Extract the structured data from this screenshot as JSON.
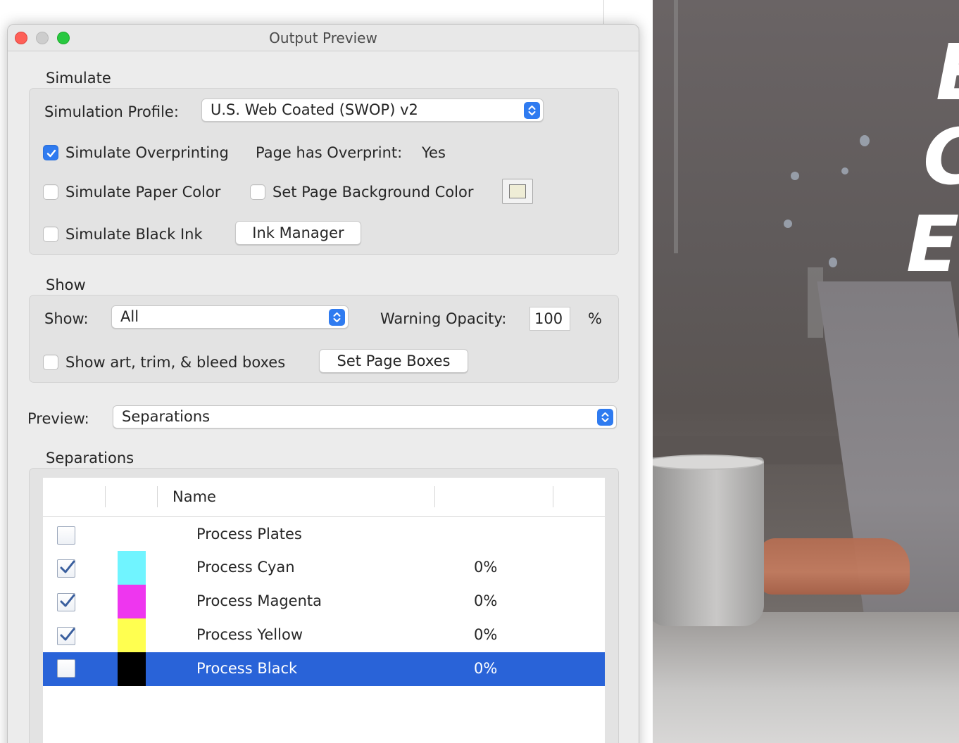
{
  "window": {
    "title": "Output Preview"
  },
  "simulate": {
    "section_title": "Simulate",
    "profile_label": "Simulation Profile:",
    "profile_value": "U.S. Web Coated (SWOP) v2",
    "overprinting_label": "Simulate Overprinting",
    "overprinting_checked": true,
    "page_has_overprint_label": "Page has Overprint:",
    "page_has_overprint_value": "Yes",
    "paper_color_label": "Simulate Paper Color",
    "paper_color_checked": false,
    "page_bg_label": "Set Page Background Color",
    "page_bg_checked": false,
    "page_bg_swatch_color": "#efedd6",
    "black_ink_label": "Simulate Black Ink",
    "black_ink_checked": false,
    "ink_manager_label": "Ink Manager"
  },
  "show": {
    "section_title": "Show",
    "show_label": "Show:",
    "show_value": "All",
    "warning_opacity_label": "Warning Opacity:",
    "warning_opacity_value": "100",
    "percent_sign": "%",
    "boxes_label": "Show art, trim, & bleed boxes",
    "boxes_checked": false,
    "set_page_boxes_label": "Set Page Boxes"
  },
  "preview": {
    "label": "Preview:",
    "value": "Separations"
  },
  "separations": {
    "section_title": "Separations",
    "column_name": "Name",
    "rows": [
      {
        "name": "Process Plates",
        "checked": false,
        "color": "",
        "percent": ""
      },
      {
        "name": "Process Cyan",
        "checked": true,
        "color": "#70f4ff",
        "percent": "0%"
      },
      {
        "name": "Process Magenta",
        "checked": true,
        "color": "#ee36ef",
        "percent": "0%"
      },
      {
        "name": "Process Yellow",
        "checked": true,
        "color": "#ffff50",
        "percent": "0%"
      },
      {
        "name": "Process Black",
        "checked": false,
        "color": "#000000",
        "percent": "0%",
        "selected": true
      }
    ]
  },
  "colors": {
    "accent": "#2f7bf0",
    "selection": "#2963d8"
  }
}
